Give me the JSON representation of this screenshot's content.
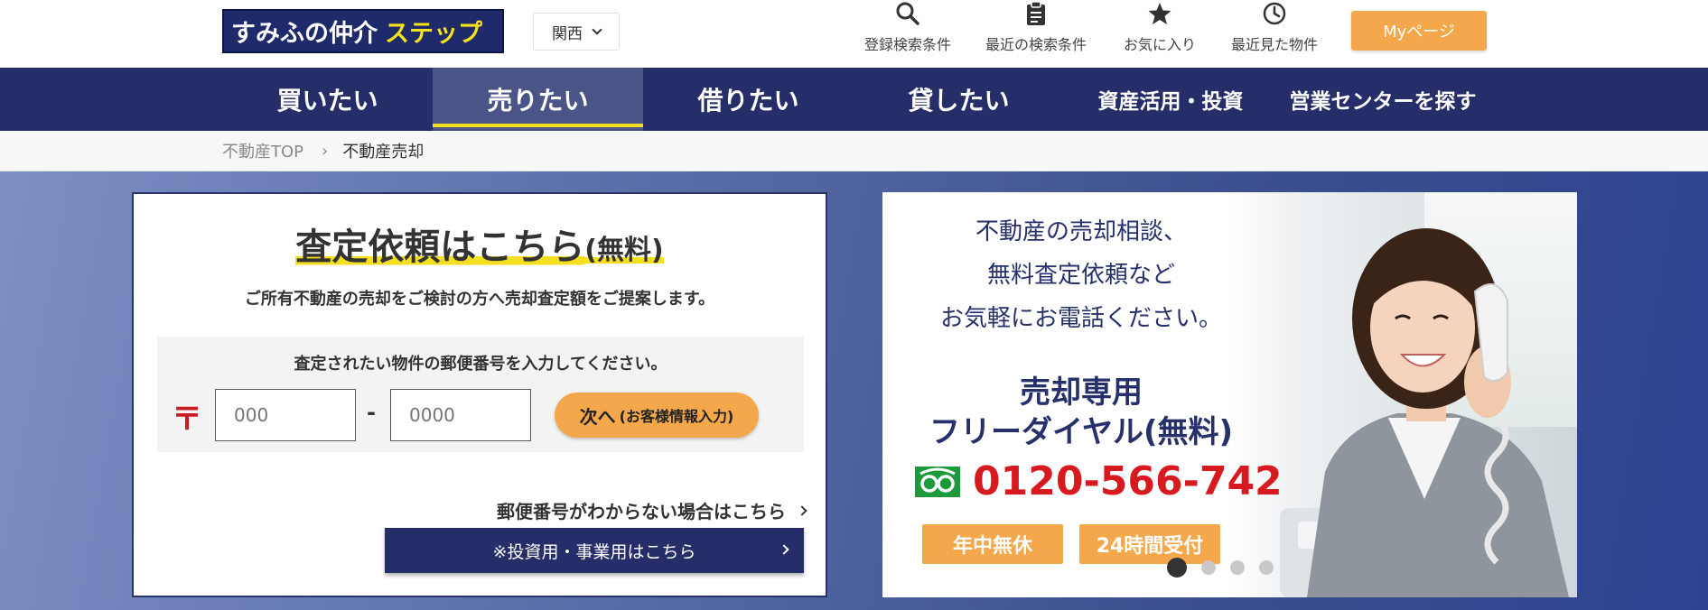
{
  "header": {
    "logo_main": "すみふの仲介",
    "logo_accent": "ステップ",
    "region": "関西",
    "nav": [
      {
        "label": "登録検索条件",
        "icon": "search-icon"
      },
      {
        "label": "最近の検索条件",
        "icon": "clipboard-icon"
      },
      {
        "label": "お気に入り",
        "icon": "star-icon"
      },
      {
        "label": "最近見た物件",
        "icon": "clock-icon"
      }
    ],
    "mypage": "Myページ"
  },
  "main_nav": {
    "tabs": [
      {
        "label": "買いたい",
        "active": false
      },
      {
        "label": "売りたい",
        "active": true
      },
      {
        "label": "借りたい",
        "active": false
      },
      {
        "label": "貸したい",
        "active": false
      },
      {
        "label": "資産活用・投資",
        "active": false
      },
      {
        "label": "営業センターを探す",
        "active": false
      }
    ]
  },
  "breadcrumb": {
    "items": [
      "不動産TOP",
      "不動産売却"
    ],
    "separator": "›"
  },
  "form": {
    "title": "査定依頼はこちら",
    "title_suffix": "(無料)",
    "subtitle": "ご所有不動産の売却をご検討の方へ売却査定額をご提案します。",
    "zip_prompt": "査定されたい物件の郵便番号を入力してください。",
    "postal_mark": "〒",
    "zip1_placeholder": "000",
    "zip_dash": "-",
    "zip2_placeholder": "0000",
    "next_label": "次へ",
    "next_sub": "(お客様情報入力)",
    "unknown_zip_link": "郵便番号がわからない場合はこちら",
    "invest_link": "※投資用・事業用はこちら"
  },
  "banner": {
    "lines": [
      "不動産の売却相談、",
      "無料査定依頼など",
      "お気軽にお電話ください。"
    ],
    "heading_1": "売却専用",
    "heading_2": "フリーダイヤル(無料)",
    "phone": "0120-566-742",
    "badge_1": "年中無休",
    "badge_2": "24時間受付",
    "slide_count": 4,
    "active_slide": 1
  },
  "colors": {
    "navy": "#252e68",
    "orange": "#f5a84b",
    "yellow": "#f3df1f",
    "red": "#d71920"
  }
}
